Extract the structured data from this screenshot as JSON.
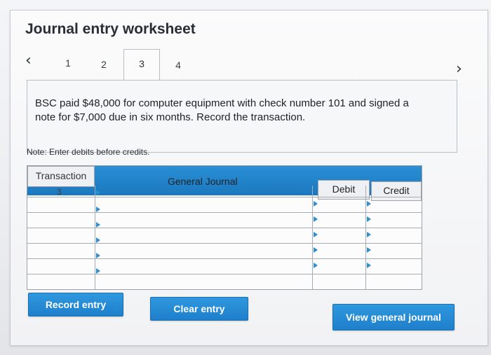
{
  "worksheet": {
    "title": "Journal entry worksheet"
  },
  "pager": {
    "prev_icon": "chevron-left-icon",
    "next_icon": "chevron-right-icon",
    "steps": [
      "1",
      "2",
      "3",
      "4"
    ],
    "active_step": "3"
  },
  "question": {
    "text": "BSC paid $48,000 for computer equipment with check number 101 and signed a note for $7,000 due in six months. Record the transaction."
  },
  "note": {
    "text": "Note: Enter debits before credits."
  },
  "table": {
    "headers": {
      "transaction": "Transaction",
      "general_journal": "General Journal",
      "debit": "Debit",
      "credit": "Credit"
    },
    "rows": [
      {
        "transaction": "3",
        "account": "",
        "debit": "",
        "credit": ""
      },
      {
        "transaction": "",
        "account": "",
        "debit": "",
        "credit": ""
      },
      {
        "transaction": "",
        "account": "",
        "debit": "",
        "credit": ""
      },
      {
        "transaction": "",
        "account": "",
        "debit": "",
        "credit": ""
      },
      {
        "transaction": "",
        "account": "",
        "debit": "",
        "credit": ""
      },
      {
        "transaction": "",
        "account": "",
        "debit": "",
        "credit": ""
      }
    ]
  },
  "buttons": {
    "record": "Record entry",
    "clear": "Clear entry",
    "view": "View general journal"
  },
  "colors": {
    "accent": "#2a8fd4",
    "button": "#1f7fca",
    "text": "#2a2d33"
  }
}
